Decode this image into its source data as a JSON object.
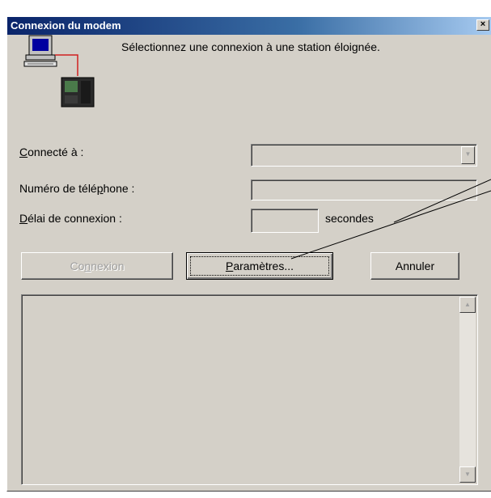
{
  "window": {
    "title": "Connexion du modem",
    "close_glyph": "×"
  },
  "icons": {
    "computer": "computer-icon",
    "modem": "modem-device-icon",
    "close": "close-icon"
  },
  "message": "Sélectionnez une connexion à une station éloignée.",
  "form": {
    "connected_to": {
      "label_accel": "C",
      "label_rest": "onnecté à :",
      "value": ""
    },
    "phone_number": {
      "label_pre": "Numéro de télé",
      "label_accel": "p",
      "label_post": "hone :",
      "value": ""
    },
    "connect_delay": {
      "label_accel": "D",
      "label_rest": "élai de connexion :",
      "value": "",
      "unit": "secondes"
    }
  },
  "buttons": {
    "connect": {
      "label_pre": "Co",
      "label_accel": "n",
      "label_post": "nexion",
      "disabled": true
    },
    "settings": {
      "label_accel": "P",
      "label_rest": "aramètres..."
    },
    "cancel": {
      "label": "Annuler"
    }
  },
  "log": {
    "content": ""
  },
  "colors": {
    "face": "#d4d0c8",
    "title_start": "#0a246a",
    "title_end": "#a6caf0",
    "link_wire": "#d02020"
  }
}
